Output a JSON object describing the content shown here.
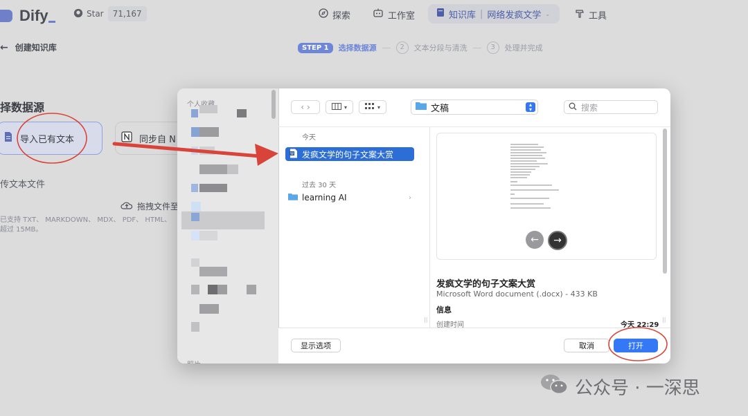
{
  "app": {
    "brand": "Dify",
    "github_star_label": "Star",
    "github_star_count": "71,167"
  },
  "nav": {
    "explore": "探索",
    "studio": "工作室",
    "knowledge": "知识库",
    "knowledge_current": "网络发疯文学",
    "tools": "工具"
  },
  "page": {
    "back_label": "创建知识库",
    "steps": [
      {
        "badge": "STEP 1",
        "label": "选择数据源"
      },
      {
        "num": "2",
        "label": "文本分段与清洗"
      },
      {
        "num": "3",
        "label": "处理并完成"
      }
    ],
    "section_title": "择数据源",
    "source_import": "导入已有文本",
    "source_notion": "同步自 N",
    "upload_title": "传文本文件",
    "upload_drag": "拖拽文件至",
    "upload_hint": "已支持 TXT、 MARKDOWN、 MDX、 PDF、 HTML、\n超过 15MB。"
  },
  "dialog": {
    "sidebar_header": "个人收藏",
    "sidebar_footer": "照片",
    "location": "文稿",
    "search_placeholder": "搜索",
    "group_today": "今天",
    "selected_file": "发疯文学的句子文案大赏",
    "group_past30": "过去 30 天",
    "folder": "learning AI",
    "preview_title": "发疯文学的句子文案大赏",
    "preview_subtitle": "Microsoft Word document (.docx) - 433 KB",
    "info_label": "信息",
    "created_label": "创建时间",
    "created_value": "今天 22:29",
    "btn_options": "显示选项",
    "btn_cancel": "取消",
    "btn_open": "打开"
  },
  "watermark": {
    "text": "公众号 · 一深思"
  },
  "colors": {
    "accent": "#3478f6",
    "dify_blue": "#6e86d8",
    "annotation_red": "#d9443a"
  }
}
